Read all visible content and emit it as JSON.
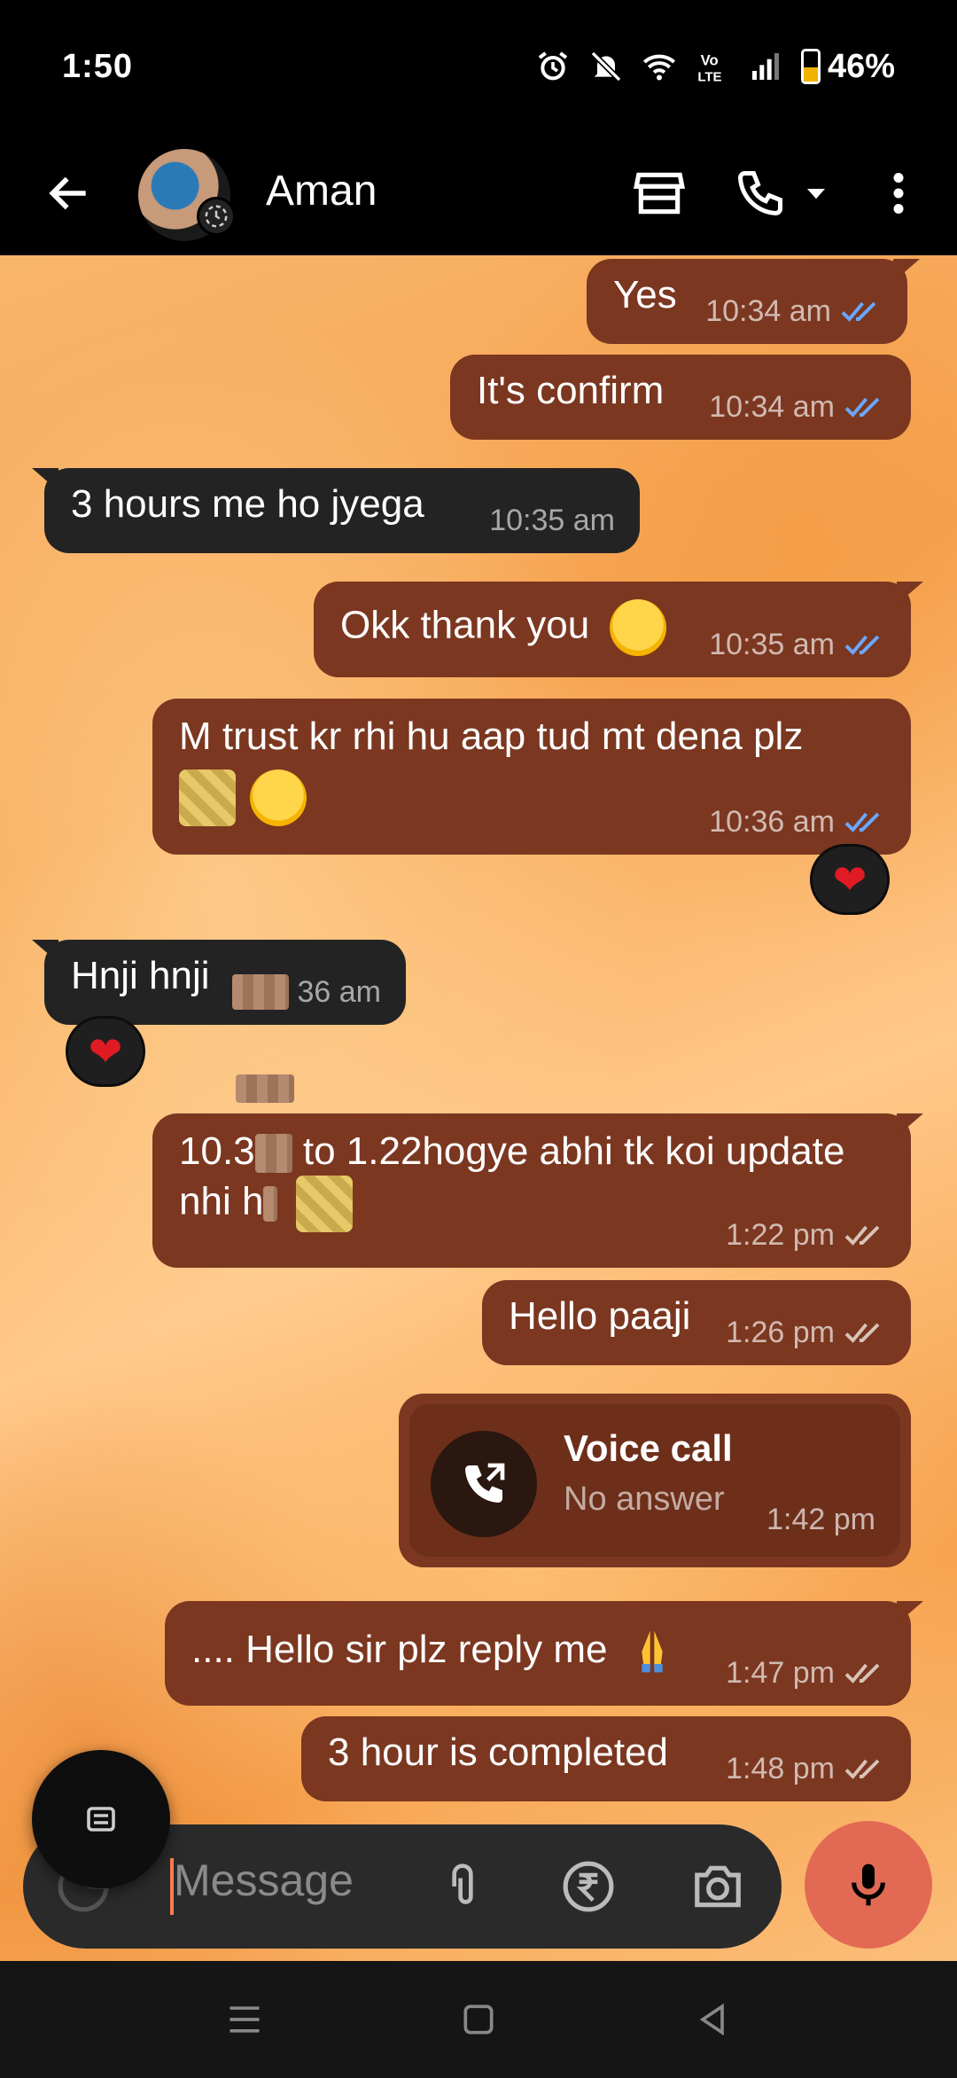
{
  "status_bar": {
    "time": "1:50",
    "battery_percent": "46%",
    "icons": [
      "alarm-icon",
      "mute-icon",
      "wifi-icon",
      "volte-icon",
      "signal-icon",
      "battery-icon"
    ]
  },
  "header": {
    "contact_name": "Aman",
    "icons": [
      "back-arrow-icon",
      "store-icon",
      "phone-icon",
      "chevron-down-icon",
      "more-vert-icon"
    ]
  },
  "messages": [
    {
      "dir": "out",
      "text": "Yes",
      "time": "10:34 am",
      "read": true
    },
    {
      "dir": "out",
      "text": "It's confirm",
      "time": "10:34 am",
      "read": true
    },
    {
      "dir": "in",
      "text": "3 hours me ho jyega",
      "time": "10:35 am"
    },
    {
      "dir": "out",
      "text": "Okk thank you",
      "time": "10:35 am",
      "read": true
    },
    {
      "dir": "out",
      "text": "M trust kr rhi hu aap tud mt dena plz",
      "time": "10:36 am",
      "read": true,
      "reaction": "❤"
    },
    {
      "dir": "in",
      "text": "Hnji hnji",
      "time": "36 am",
      "reaction": "❤"
    },
    {
      "dir": "out",
      "text_part1": "10.3",
      "text_part2": " to 1.22hogye abhi tk koi update",
      "text_part3": "nhi h",
      "time": "1:22 pm",
      "read": false
    },
    {
      "dir": "out",
      "text": "Hello paaji",
      "time": "1:26 pm",
      "read": false
    },
    {
      "dir": "out",
      "text": ".... Hello sir plz reply me",
      "time": "1:47 pm",
      "read": false
    },
    {
      "dir": "out",
      "text": "3 hour is completed",
      "time": "1:48 pm",
      "read": false
    }
  ],
  "call": {
    "title": "Voice call",
    "subtitle": "No answer",
    "time": "1:42 pm"
  },
  "composer": {
    "placeholder": "Message",
    "icons": [
      "sticker-icon",
      "attach-icon",
      "rupee-payment-icon",
      "camera-icon",
      "mic-icon"
    ]
  },
  "colors": {
    "outgoing_bubble": "#7b3720",
    "incoming_bubble": "#232323",
    "read_tick": "#6aa8ff",
    "mic_button": "#e26a54"
  }
}
